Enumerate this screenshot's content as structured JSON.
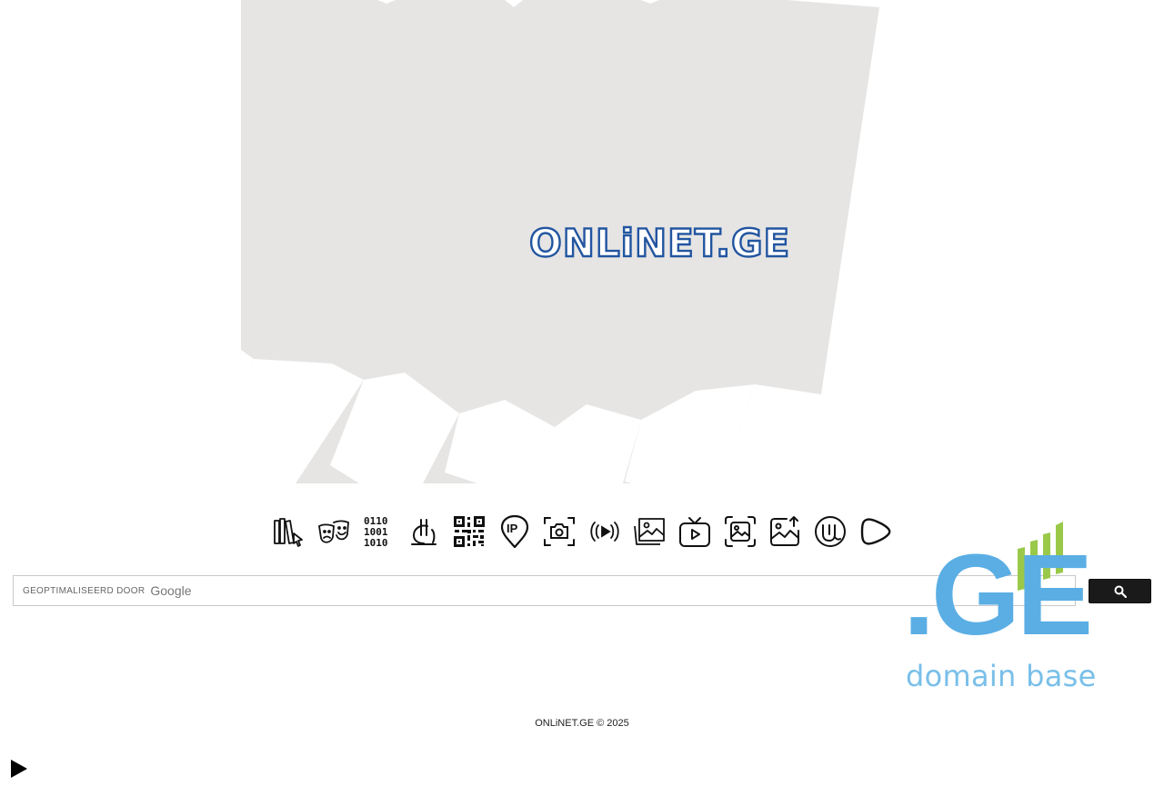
{
  "hero": {
    "logo_text": "ONLiNET.GE",
    "shape_color": "#e6e5e4",
    "logo_color": "#2255a0"
  },
  "toolbar": {
    "icons": [
      "books-cursor-icon",
      "theater-masks-icon",
      "binary-code-icon",
      "lari-currency-icon",
      "qr-code-icon",
      "ip-location-pin-icon",
      "camera-capture-icon",
      "broadcast-play-icon",
      "gallery-icon",
      "tv-play-icon",
      "image-frame-icon",
      "image-upload-icon",
      "utorrent-icon",
      "rumble-play-icon"
    ],
    "binary_lines": [
      "0110",
      "1001",
      "1010"
    ],
    "ip_label": "IP"
  },
  "search": {
    "powered_by_label": "GEOPTIMALISEERD DOOR",
    "google_label": "Google",
    "value": "",
    "button_icon": "search-icon"
  },
  "domain_logo": {
    "text": ".GE",
    "caption": "domain base",
    "colors": {
      "blue": "#5aaee4",
      "green": "#9ac94a"
    }
  },
  "footer": {
    "text": "ONLiNET.GE © 2025"
  },
  "player": {
    "icon": "play-icon"
  }
}
